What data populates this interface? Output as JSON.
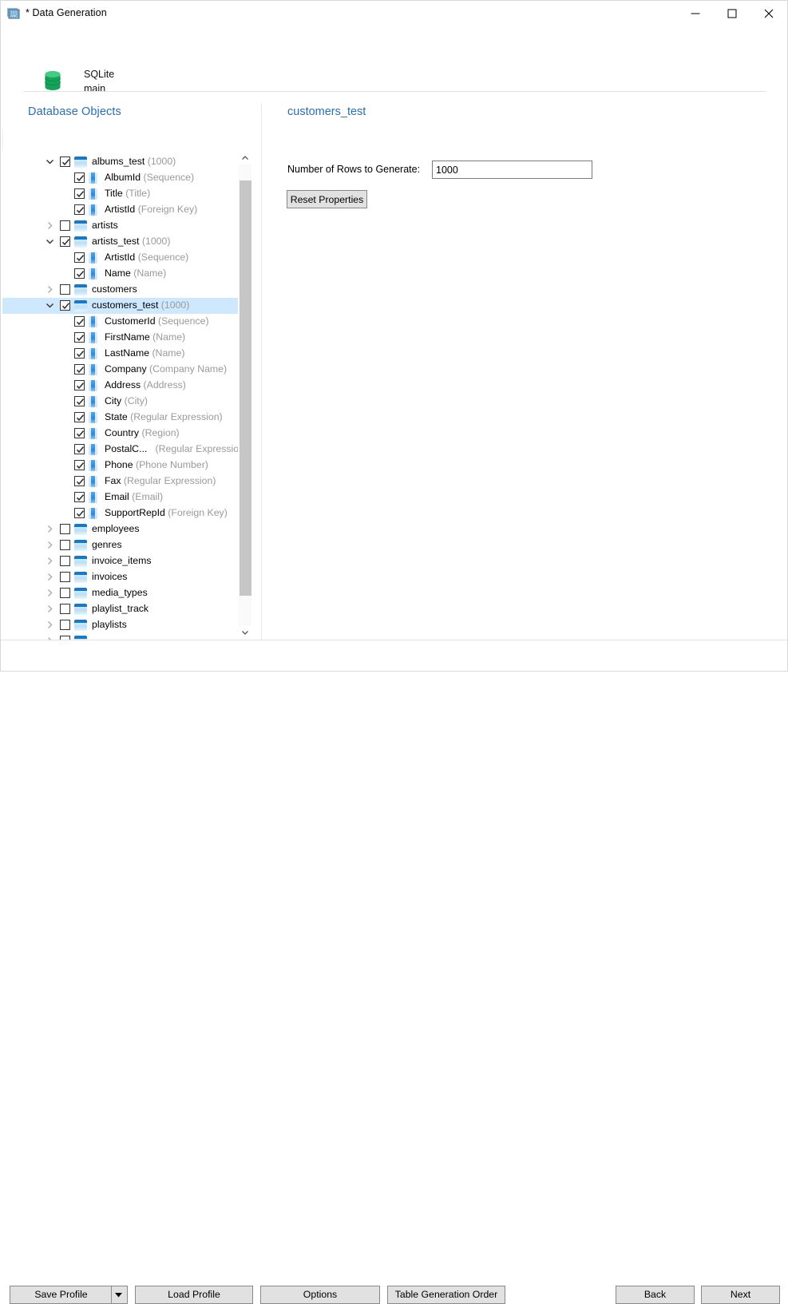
{
  "window": {
    "title": "* Data Generation",
    "icon": "data-generation-icon",
    "controls": {
      "minimize": "minimize",
      "maximize": "maximize",
      "close": "close"
    }
  },
  "header": {
    "db_icon": "database-cylinder-icon",
    "db_name": "SQLite",
    "db_schema": "main"
  },
  "left_panel": {
    "title": "Database Objects",
    "scrollbar": {
      "up": "scroll-up",
      "down": "scroll-down"
    },
    "tree": [
      {
        "level": 0,
        "label": "albums_test",
        "sub": "(1000)",
        "checked": true,
        "expanded": true,
        "chevron": true,
        "icon": "table-icon",
        "selected": false
      },
      {
        "level": 1,
        "label": "AlbumId",
        "sub": "(Sequence)",
        "checked": true,
        "expanded": false,
        "chevron": false,
        "icon": "column-icon",
        "selected": false
      },
      {
        "level": 1,
        "label": "Title",
        "sub": "(Title)",
        "checked": true,
        "expanded": false,
        "chevron": false,
        "icon": "column-icon",
        "selected": false
      },
      {
        "level": 1,
        "label": "ArtistId",
        "sub": "(Foreign Key)",
        "checked": true,
        "expanded": false,
        "chevron": false,
        "icon": "column-icon",
        "selected": false
      },
      {
        "level": 0,
        "label": "artists",
        "sub": "",
        "checked": false,
        "expanded": false,
        "chevron": true,
        "icon": "table-icon",
        "selected": false
      },
      {
        "level": 0,
        "label": "artists_test",
        "sub": "(1000)",
        "checked": true,
        "expanded": true,
        "chevron": true,
        "icon": "table-icon",
        "selected": false
      },
      {
        "level": 1,
        "label": "ArtistId",
        "sub": "(Sequence)",
        "checked": true,
        "expanded": false,
        "chevron": false,
        "icon": "column-icon",
        "selected": false
      },
      {
        "level": 1,
        "label": "Name",
        "sub": "(Name)",
        "checked": true,
        "expanded": false,
        "chevron": false,
        "icon": "column-icon",
        "selected": false
      },
      {
        "level": 0,
        "label": "customers",
        "sub": "",
        "checked": false,
        "expanded": false,
        "chevron": true,
        "icon": "table-icon",
        "selected": false
      },
      {
        "level": 0,
        "label": "customers_test",
        "sub": "(1000)",
        "checked": true,
        "expanded": true,
        "chevron": true,
        "icon": "table-icon",
        "selected": true
      },
      {
        "level": 1,
        "label": "CustomerId",
        "sub": "(Sequence)",
        "checked": true,
        "expanded": false,
        "chevron": false,
        "icon": "column-icon",
        "selected": false
      },
      {
        "level": 1,
        "label": "FirstName",
        "sub": "(Name)",
        "checked": true,
        "expanded": false,
        "chevron": false,
        "icon": "column-icon",
        "selected": false
      },
      {
        "level": 1,
        "label": "LastName",
        "sub": "(Name)",
        "checked": true,
        "expanded": false,
        "chevron": false,
        "icon": "column-icon",
        "selected": false
      },
      {
        "level": 1,
        "label": "Company",
        "sub": "(Company Name)",
        "checked": true,
        "expanded": false,
        "chevron": false,
        "icon": "column-icon",
        "selected": false
      },
      {
        "level": 1,
        "label": "Address",
        "sub": "(Address)",
        "checked": true,
        "expanded": false,
        "chevron": false,
        "icon": "column-icon",
        "selected": false
      },
      {
        "level": 1,
        "label": "City",
        "sub": "(City)",
        "checked": true,
        "expanded": false,
        "chevron": false,
        "icon": "column-icon",
        "selected": false
      },
      {
        "level": 1,
        "label": "State",
        "sub": "(Regular Expression)",
        "checked": true,
        "expanded": false,
        "chevron": false,
        "icon": "column-icon",
        "selected": false
      },
      {
        "level": 1,
        "label": "Country",
        "sub": "(Region)",
        "checked": true,
        "expanded": false,
        "chevron": false,
        "icon": "column-icon",
        "selected": false
      },
      {
        "level": 1,
        "label": "PostalC...",
        "sub": "(Regular Expression)",
        "checked": true,
        "expanded": false,
        "chevron": false,
        "icon": "column-icon",
        "selected": false
      },
      {
        "level": 1,
        "label": "Phone",
        "sub": "(Phone Number)",
        "checked": true,
        "expanded": false,
        "chevron": false,
        "icon": "column-icon",
        "selected": false
      },
      {
        "level": 1,
        "label": "Fax",
        "sub": "(Regular Expression)",
        "checked": true,
        "expanded": false,
        "chevron": false,
        "icon": "column-icon",
        "selected": false
      },
      {
        "level": 1,
        "label": "Email",
        "sub": "(Email)",
        "checked": true,
        "expanded": false,
        "chevron": false,
        "icon": "column-icon",
        "selected": false
      },
      {
        "level": 1,
        "label": "SupportRepId",
        "sub": "(Foreign Key)",
        "checked": true,
        "expanded": false,
        "chevron": false,
        "icon": "column-icon",
        "selected": false
      },
      {
        "level": 0,
        "label": "employees",
        "sub": "",
        "checked": false,
        "expanded": false,
        "chevron": true,
        "icon": "table-icon",
        "selected": false
      },
      {
        "level": 0,
        "label": "genres",
        "sub": "",
        "checked": false,
        "expanded": false,
        "chevron": true,
        "icon": "table-icon",
        "selected": false
      },
      {
        "level": 0,
        "label": "invoice_items",
        "sub": "",
        "checked": false,
        "expanded": false,
        "chevron": true,
        "icon": "table-icon",
        "selected": false
      },
      {
        "level": 0,
        "label": "invoices",
        "sub": "",
        "checked": false,
        "expanded": false,
        "chevron": true,
        "icon": "table-icon",
        "selected": false
      },
      {
        "level": 0,
        "label": "media_types",
        "sub": "",
        "checked": false,
        "expanded": false,
        "chevron": true,
        "icon": "table-icon",
        "selected": false
      },
      {
        "level": 0,
        "label": "playlist_track",
        "sub": "",
        "checked": false,
        "expanded": false,
        "chevron": true,
        "icon": "table-icon",
        "selected": false
      },
      {
        "level": 0,
        "label": "playlists",
        "sub": "",
        "checked": false,
        "expanded": false,
        "chevron": true,
        "icon": "table-icon",
        "selected": false
      },
      {
        "level": 0,
        "label": "",
        "sub": "",
        "checked": false,
        "expanded": false,
        "chevron": true,
        "icon": "table-icon",
        "selected": false
      }
    ]
  },
  "right_panel": {
    "title": "customers_test",
    "rows_label": "Number of Rows to Generate:",
    "rows_value": "1000",
    "reset_label": "Reset Properties"
  },
  "footer": {
    "save_profile": "Save Profile",
    "load_profile": "Load Profile",
    "options": "Options",
    "table_generation_order": "Table Generation Order",
    "back": "Back",
    "next": "Next"
  },
  "colors": {
    "accent_blue": "#2a6fb5",
    "selection": "#cde8ff",
    "table_icon": "#1878c8",
    "db_green": "#1faa59",
    "button_face": "#e1e1e1"
  }
}
